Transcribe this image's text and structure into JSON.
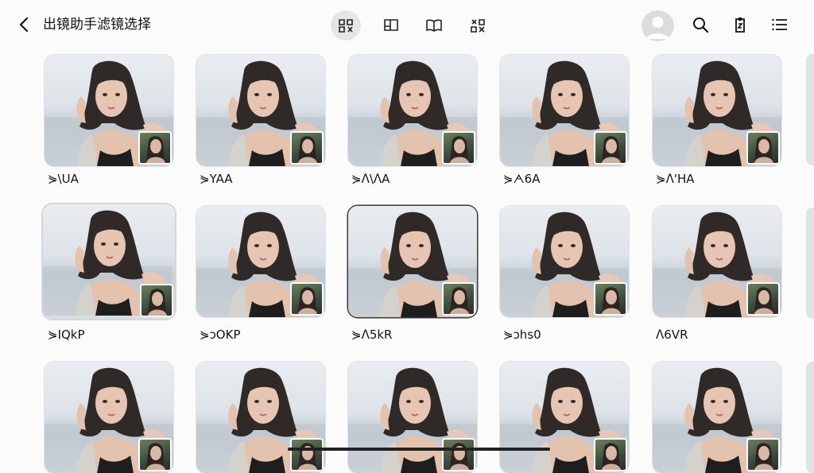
{
  "header": {
    "title": "出镜助手滤镜选择",
    "tabs": [
      {
        "icon": "grid-icon",
        "active": true
      },
      {
        "icon": "frame-icon",
        "active": false
      },
      {
        "icon": "book-icon",
        "active": false
      },
      {
        "icon": "layout-icon",
        "active": false
      }
    ],
    "actions": [
      "avatar",
      "search-icon",
      "clipboard-icon",
      "menu-icon"
    ]
  },
  "filters": [
    {
      "label": "⋟\\UA"
    },
    {
      "label": "⋟YAA"
    },
    {
      "label": "⋟ᐱ\\ᐱA"
    },
    {
      "label": "⋟ᗅ6A"
    },
    {
      "label": "⋟ᐱ'HA"
    },
    {
      "label": "⋟IQkP"
    },
    {
      "label": "⋟ɔOKP"
    },
    {
      "label": "⋟ᐱ5kR"
    },
    {
      "label": "⋟ɔhs0"
    },
    {
      "label": "ᐱ6VR"
    },
    {
      "label": ""
    },
    {
      "label": ""
    },
    {
      "label": ""
    },
    {
      "label": ""
    },
    {
      "label": ""
    }
  ],
  "colors": {
    "background": "#fbfbfb",
    "active_tab": "#e6e6e6"
  }
}
